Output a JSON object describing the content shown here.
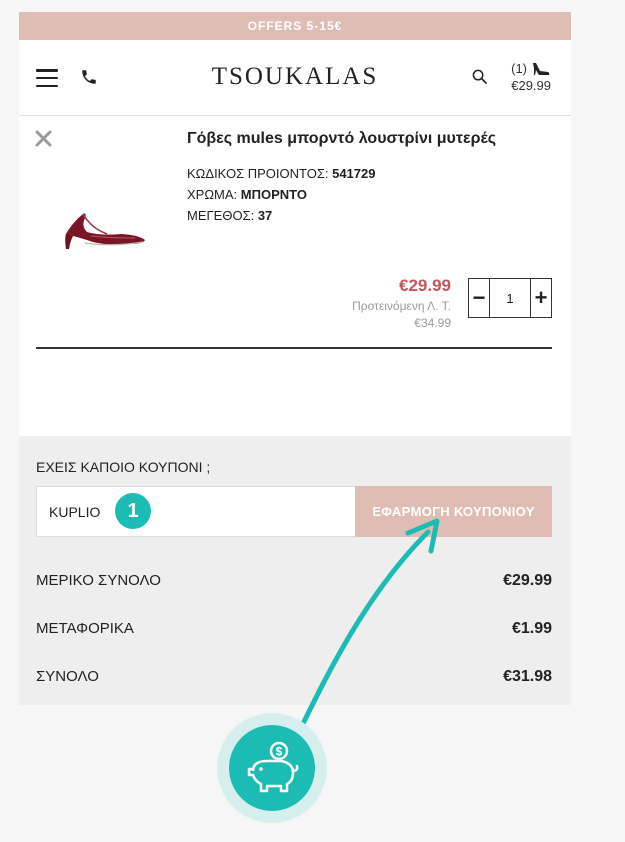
{
  "offer_bar": {
    "text": "OFFERS 5-15€"
  },
  "header": {
    "logo": "TSOUKALAS",
    "cart_count": "(1)",
    "cart_total": "€29.99"
  },
  "cart_item": {
    "title": "Γόβες mules μπορντό λουστρίνι μυτερές",
    "code_label": "ΚΩΔΙΚΟΣ ΠΡΟΙΟΝΤΟΣ:",
    "code_value": "541729",
    "color_label": "ΧΡΩΜΑ:",
    "color_value": "ΜΠΟΡΝΤΟ",
    "size_label": "ΜΕΓΕΘΟΣ:",
    "size_value": "37",
    "price": "€29.99",
    "suggested_label": "Προτεινόμενη Λ. Τ.",
    "old_price": "€34.99",
    "quantity": "1",
    "minus": "−",
    "plus": "+"
  },
  "coupon": {
    "question": "ΕΧΕΙΣ ΚΑΠΟΙΟ ΚΟΥΠΟΝΙ ;",
    "input_value": "KUPLIO",
    "apply_label": "ΕΦΑΡΜΟΓΗ ΚΟΥΠΟΝΙΟΥ",
    "step_badge": "1"
  },
  "totals": {
    "subtotal_label": "ΜΕΡΙΚΟ ΣΥΝΟΛΟ",
    "subtotal_value": "€29.99",
    "shipping_label": "ΜΕΤΑΦΟΡΙΚΑ",
    "shipping_value": "€1.99",
    "total_label": "ΣΥΝΟΛΟ",
    "total_value": "€31.98"
  },
  "colors": {
    "accent_pink": "#dfbdb5",
    "price_red": "#c5565a",
    "teal": "#1cbcb4"
  },
  "icons": [
    "hamburger-menu-icon",
    "phone-icon",
    "search-icon",
    "shoe-icon",
    "close-icon",
    "piggy-bank-icon",
    "arrow-annotation"
  ]
}
